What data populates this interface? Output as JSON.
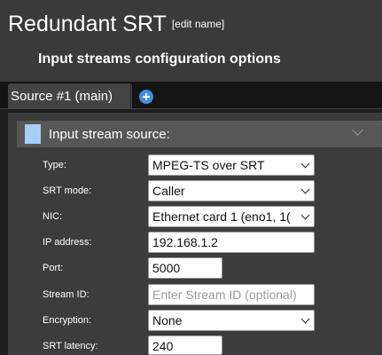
{
  "header": {
    "title": "Redundant SRT",
    "edit_name_link": "[edit name]",
    "subtitle": "Input streams configuration options"
  },
  "tabs": {
    "items": [
      {
        "label": "Source #1 (main)"
      }
    ],
    "add_icon": "plus-circle-icon"
  },
  "section": {
    "label": "Input stream source:",
    "marker_color": "#a7cff5",
    "collapse_icon": "chevron-down-icon"
  },
  "form": {
    "type": {
      "label": "Type:",
      "value": "MPEG-TS over SRT"
    },
    "srt_mode": {
      "label": "SRT mode:",
      "value": "Caller"
    },
    "nic": {
      "label": "NIC:",
      "value": "Ethernet card 1 (eno1, 1("
    },
    "ip_address": {
      "label": "IP address:",
      "value": "192.168.1.2"
    },
    "port": {
      "label": "Port:",
      "value": "5000"
    },
    "stream_id": {
      "label": "Stream ID:",
      "value": "",
      "placeholder": "Enter Stream ID (optional)"
    },
    "encryption": {
      "label": "Encryption:",
      "value": "None"
    },
    "srt_latency": {
      "label": "SRT latency:",
      "value": "240"
    }
  },
  "colors": {
    "accent": "#3d8fe0",
    "header_bg": "#3a3a3a",
    "panel_bg": "#3c3c3c",
    "section_bg": "#575757"
  }
}
